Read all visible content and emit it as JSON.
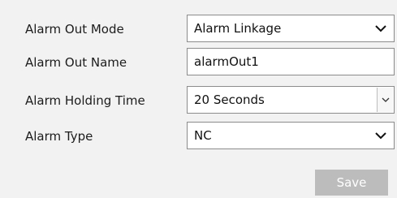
{
  "form": {
    "alarm_out_mode": {
      "label": "Alarm Out Mode",
      "value": "Alarm Linkage"
    },
    "alarm_out_name": {
      "label": "Alarm Out Name",
      "value": "alarmOut1"
    },
    "alarm_holding_time": {
      "label": "Alarm Holding Time",
      "value": "20 Seconds"
    },
    "alarm_type": {
      "label": "Alarm Type",
      "value": "NC"
    }
  },
  "actions": {
    "save_label": "Save"
  },
  "icons": {
    "dropdown": "chevron-down-icon"
  }
}
